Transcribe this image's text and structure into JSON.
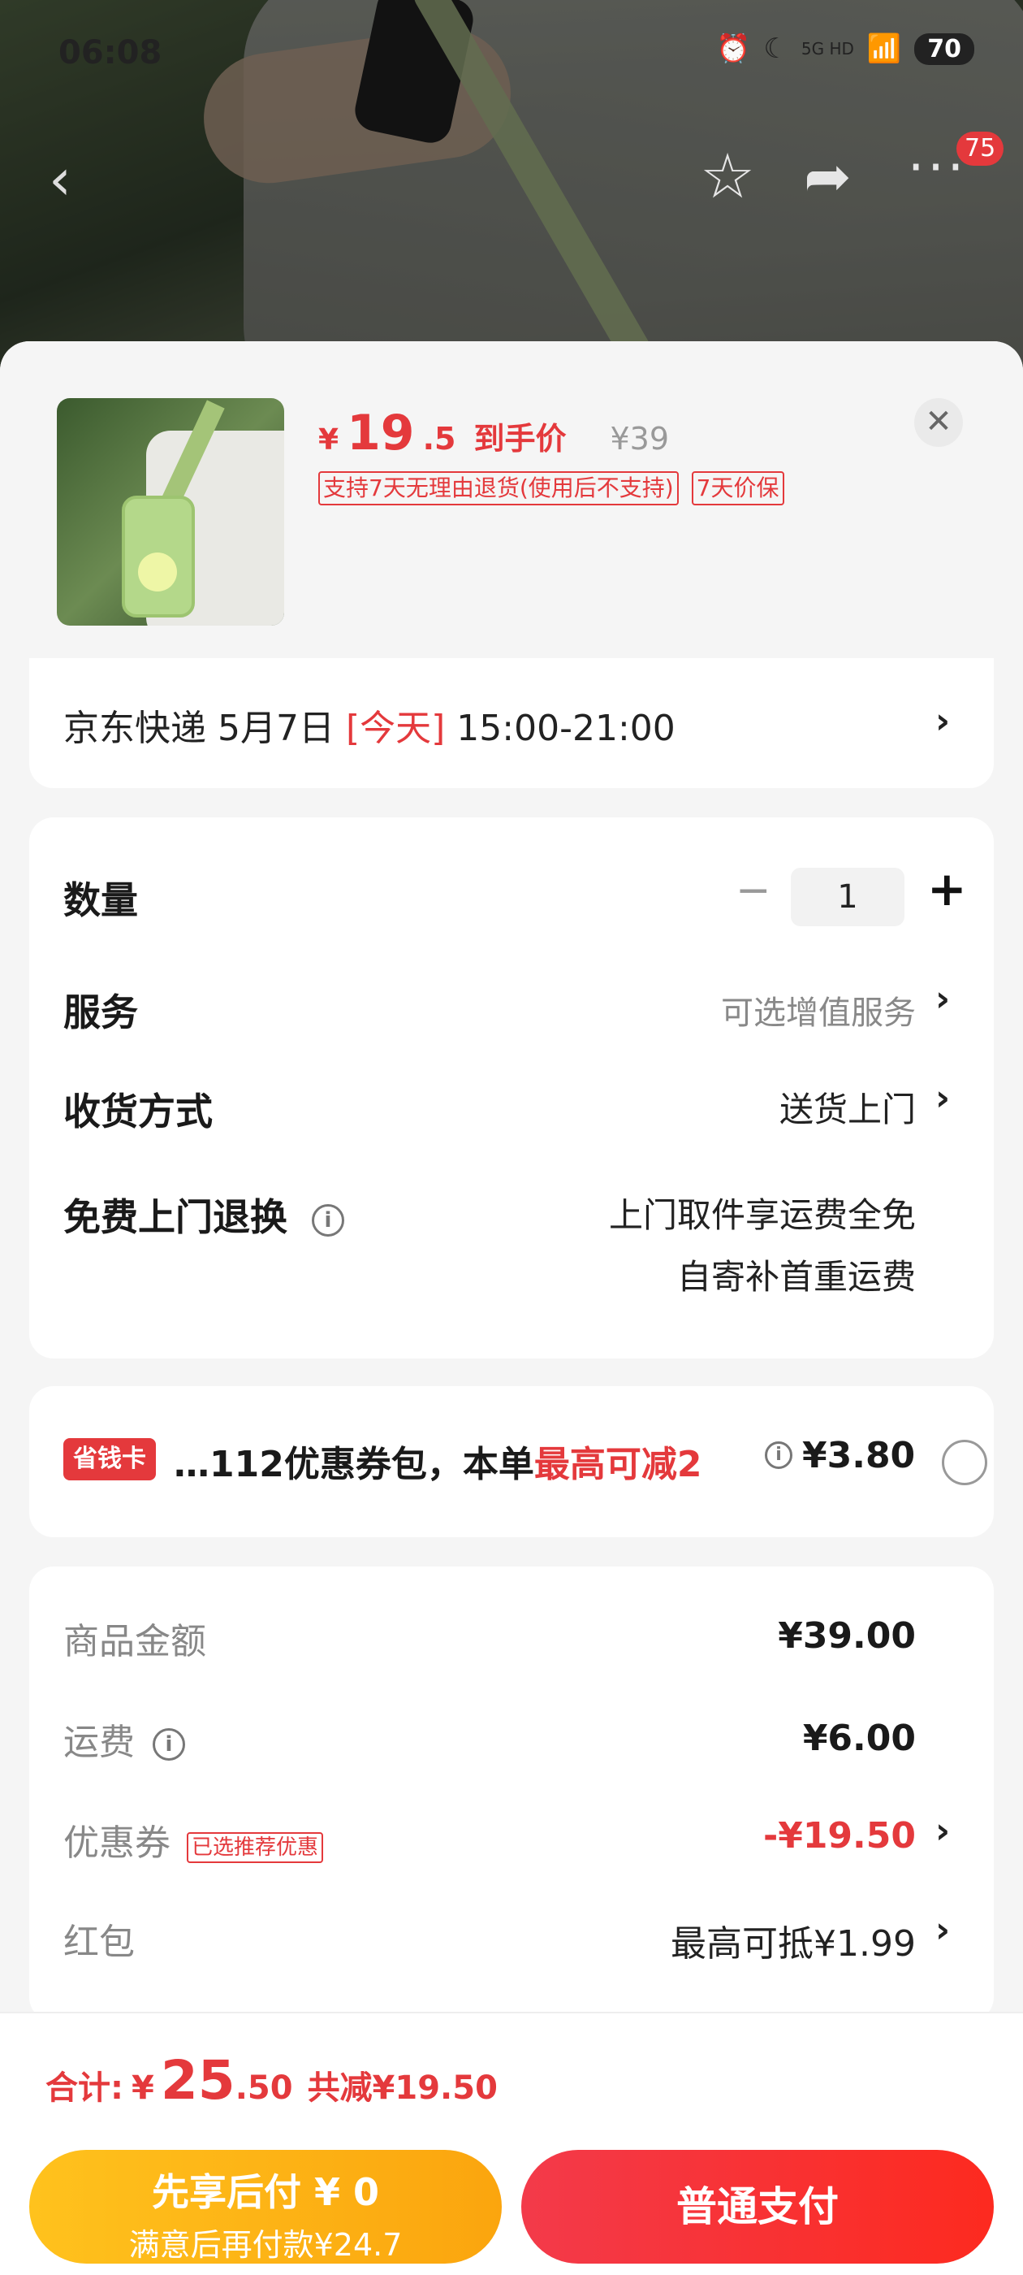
{
  "status": {
    "time": "06:08",
    "network": "5G HD",
    "battery": "70"
  },
  "nav": {
    "cart_badge": "75"
  },
  "product": {
    "price_currency": "¥",
    "price_int": "19",
    "price_dec": ".5",
    "price_label": "到手价",
    "original_price": "¥39",
    "tags": [
      "支持7天无理由退货(使用后不支持)",
      "7天价保"
    ]
  },
  "delivery": {
    "prefix": "京东快递 5月7日 ",
    "today": "[今天]",
    "window": " 15:00-21:00"
  },
  "options": {
    "quantity_label": "数量",
    "quantity_value": "1",
    "service_label": "服务",
    "service_value": "可选增值服务",
    "receive_label": "收货方式",
    "receive_value": "送货上门",
    "return_label": "免费上门退换",
    "return_value_1": "上门取件享运费全免",
    "return_value_2": "自寄补首重运费"
  },
  "coupon_pack": {
    "badge": "省钱卡",
    "text_prefix": "…112优惠券包，本单",
    "text_red": "最高可减2",
    "amount": "¥3.80"
  },
  "summary": {
    "goods_label": "商品金额",
    "goods_value": "¥39.00",
    "shipping_label": "运费",
    "shipping_value": "¥6.00",
    "coupon_label": "优惠券",
    "coupon_tag": "已选推荐优惠",
    "coupon_value": "-¥19.50",
    "redpacket_label": "红包",
    "redpacket_value": "最高可抵¥1.99"
  },
  "total": {
    "label": "合计:",
    "currency": "¥",
    "int": "25",
    "dec": ".50",
    "save": "共减¥19.50"
  },
  "buttons": {
    "pay_later_line1": "先享后付 ¥ 0",
    "pay_later_line2": "满意后再付款¥24.7",
    "pay_normal": "普通支付"
  },
  "colors": {
    "accent_red": "#e4393c",
    "pay_later_yellow": "#ffc21d",
    "pay_red": "#f33a4a"
  }
}
